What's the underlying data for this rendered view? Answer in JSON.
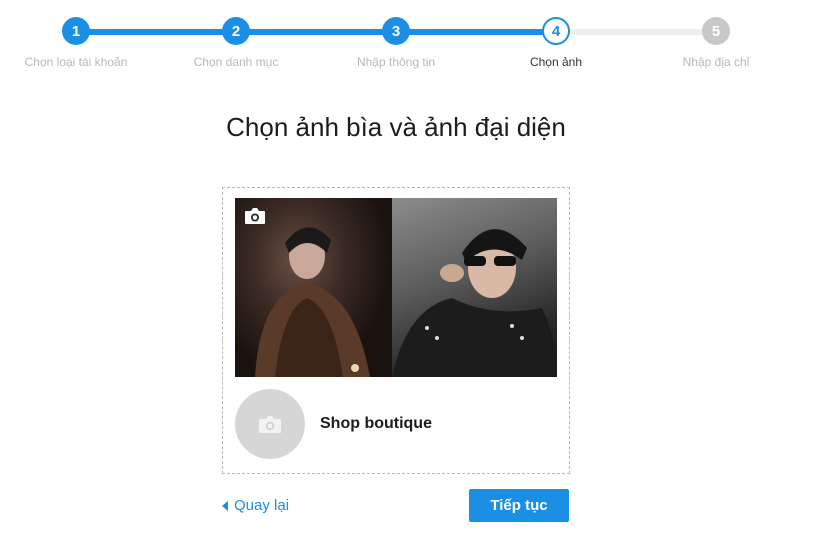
{
  "stepper": {
    "steps": [
      {
        "number": "1",
        "label": "Chọn loại tài khoản",
        "state": "done"
      },
      {
        "number": "2",
        "label": "Chọn danh mục",
        "state": "done"
      },
      {
        "number": "3",
        "label": "Nhập thông tin",
        "state": "done"
      },
      {
        "number": "4",
        "label": "Chọn ảnh",
        "state": "current"
      },
      {
        "number": "5",
        "label": "Nhập địa chỉ",
        "state": "todo"
      }
    ]
  },
  "page": {
    "title": "Chọn ảnh bìa và ảnh đại diện"
  },
  "preview": {
    "cover_icon": "camera-icon",
    "avatar_icon": "camera-icon",
    "shop_name": "Shop boutique"
  },
  "actions": {
    "back_label": "Quay lại",
    "next_label": "Tiếp tục"
  },
  "colors": {
    "accent": "#1a8fe3",
    "inactive": "#c8c8c8",
    "track_inactive": "#eeeeee"
  }
}
